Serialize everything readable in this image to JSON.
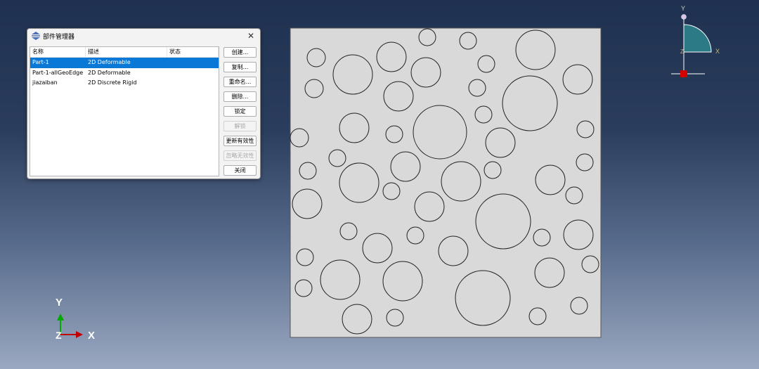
{
  "dialog": {
    "title": "部件管理器",
    "close_glyph": "✕",
    "columns": [
      "名称",
      "描述",
      "状态"
    ],
    "rows": [
      {
        "name": "Part-1",
        "description": "2D Deformable",
        "status": "",
        "selected": true
      },
      {
        "name": "Part-1-allGeoEdge",
        "description": "2D Deformable",
        "status": "",
        "selected": false
      },
      {
        "name": "jiazaiban",
        "description": "2D Discrete Rigid",
        "status": "",
        "selected": false
      }
    ],
    "buttons": [
      {
        "label": "创建...",
        "enabled": true
      },
      {
        "label": "复制...",
        "enabled": true
      },
      {
        "label": "重命名...",
        "enabled": true
      },
      {
        "label": "删除...",
        "enabled": true
      },
      {
        "label": "锁定",
        "enabled": true
      },
      {
        "label": "解锁",
        "enabled": false
      },
      {
        "label": "更新有效性",
        "enabled": true
      },
      {
        "label": "忽略无效性",
        "enabled": false
      },
      {
        "label": "关闭",
        "enabled": true
      }
    ]
  },
  "triad_main": {
    "x_label": "X",
    "y_label": "Y",
    "z_label": "Z"
  },
  "triad_view": {
    "x_label": "X",
    "y_label": "Y",
    "z_label": "Z"
  },
  "colors": {
    "selection": "#0a78d7",
    "triad_x": "#c00000",
    "triad_y": "#00aa00",
    "triad_z": "#1a2a9a",
    "triad_quadrant": "#2b7a86",
    "part_fill": "#d9d9d9"
  }
}
